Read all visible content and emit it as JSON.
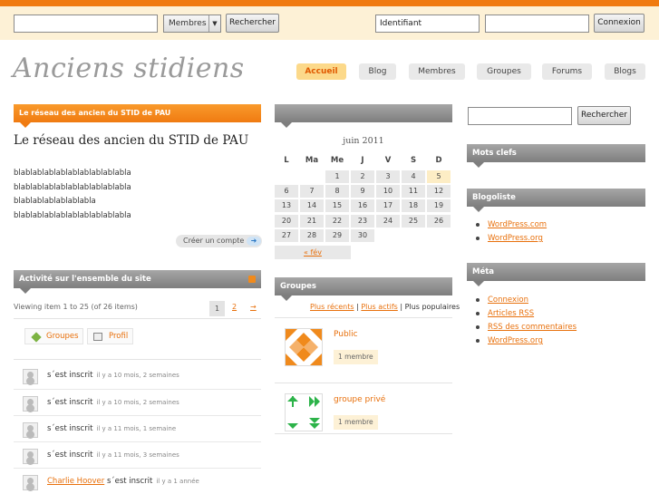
{
  "admin_bar": {
    "search_value": "",
    "search_scope": "Membres",
    "search_button": "Rechercher",
    "login_value": "Identifiant",
    "password_value": "",
    "login_button": "Connexion"
  },
  "site": {
    "title": "Anciens stidiens"
  },
  "nav": {
    "tabs": [
      "Accueil",
      "Blog",
      "Membres",
      "Groupes",
      "Forums",
      "Blogs"
    ],
    "active": "Accueil"
  },
  "welcome": {
    "header": "Le réseau des ancien du STID de PAU",
    "title": "Le réseau des ancien du STID de PAU",
    "lines": [
      "blablablablablablablablablabla",
      "blablablablablablablablablabla",
      "blablablablablablabla",
      "blablablablablablablablablabla"
    ],
    "create_account": "Créer un compte"
  },
  "activity": {
    "header": "Activité sur l'ensemble du site",
    "count_text": "Viewing item 1 to 25 (of 26 items)",
    "pages": [
      "1",
      "2",
      "→"
    ],
    "filter_groups": "Groupes",
    "filter_profile": "Profil",
    "items": [
      {
        "user": "",
        "action": "s´est inscrit",
        "time": "il y a 10 mois, 2 semaines"
      },
      {
        "user": "",
        "action": "s´est inscrit",
        "time": "il y a 10 mois, 2 semaines"
      },
      {
        "user": "",
        "action": "s´est inscrit",
        "time": "il y a 11 mois, 1 semaine"
      },
      {
        "user": "",
        "action": "s´est inscrit",
        "time": "il y a 11 mois, 3 semaines"
      },
      {
        "user": "Charlie Hoover",
        "action": "s´est inscrit",
        "time": "il y a 1 année"
      }
    ]
  },
  "calendar": {
    "month": "juin 2011",
    "weekdays": [
      "L",
      "Ma",
      "Me",
      "J",
      "V",
      "S",
      "D"
    ],
    "weeks": [
      [
        "",
        "",
        "1",
        "2",
        "3",
        "4",
        "5"
      ],
      [
        "6",
        "7",
        "8",
        "9",
        "10",
        "11",
        "12"
      ],
      [
        "13",
        "14",
        "15",
        "16",
        "17",
        "18",
        "19"
      ],
      [
        "20",
        "21",
        "22",
        "23",
        "24",
        "25",
        "26"
      ],
      [
        "27",
        "28",
        "29",
        "30",
        "",
        "",
        ""
      ]
    ],
    "today": "5",
    "prev_link": "« fév"
  },
  "groups": {
    "header": "Groupes",
    "filter_recent": "Plus récents",
    "filter_active": "Plus actifs",
    "filter_popular": "Plus populaires",
    "separator": "|",
    "items": [
      {
        "name": "Public",
        "members": "1 membre"
      },
      {
        "name": "groupe privé",
        "members": "1 membre"
      }
    ]
  },
  "sidebar": {
    "search_button": "Rechercher",
    "search_value": "",
    "tags_header": "Mots clefs",
    "blogroll_header": "Blogoliste",
    "blogroll": [
      "WordPress.com",
      "WordPress.org"
    ],
    "meta_header": "Méta",
    "meta": [
      "Connexion",
      "Articles RSS",
      "RSS des commentaires",
      "WordPress.org"
    ]
  },
  "colors": {
    "accent": "#f07b11",
    "admin_bar_bg": "#fdf1d6",
    "link": "#e8700c"
  }
}
